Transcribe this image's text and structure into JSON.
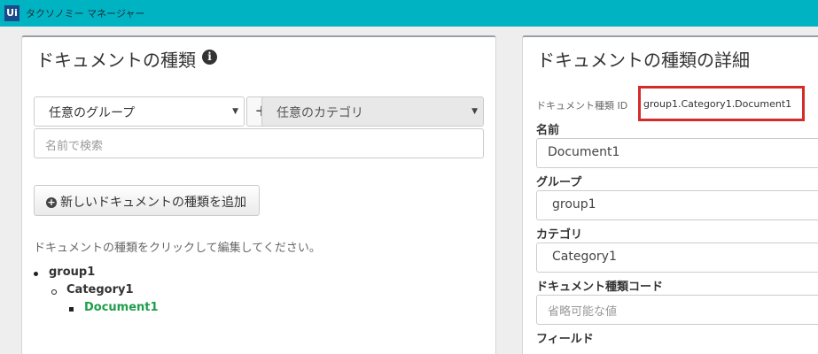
{
  "app": {
    "logo_text": "Ui",
    "title": "タクソノミー マネージャー"
  },
  "left_panel": {
    "title": "ドキュメントの種類",
    "group_select": {
      "value": "任意のグループ"
    },
    "add_group_label": "+",
    "category_select": {
      "value": "任意のカテゴリ"
    },
    "search": {
      "placeholder": "名前で検索",
      "value": ""
    },
    "add_button_label": "新しいドキュメントの種類を追加",
    "hint": "ドキュメントの種類をクリックして編集してください。",
    "tree": {
      "group": "group1",
      "category": "Category1",
      "document": "Document1"
    }
  },
  "right_panel": {
    "title": "ドキュメントの種類の詳細",
    "id_label": "ドキュメント種類 ID",
    "id_value": "group1.Category1.Document1",
    "fields": {
      "name": {
        "label": "名前",
        "value": "Document1"
      },
      "group": {
        "label": "グループ",
        "value": "group1"
      },
      "category": {
        "label": "カテゴリ",
        "value": "Category1"
      },
      "code": {
        "label": "ドキュメント種類コード",
        "placeholder": "省略可能な値",
        "value": ""
      },
      "fields_label": "フィールド"
    }
  },
  "colors": {
    "titlebar": "#00b3c3",
    "link_green": "#1e9e4a",
    "highlight_red": "#d42b2b"
  }
}
